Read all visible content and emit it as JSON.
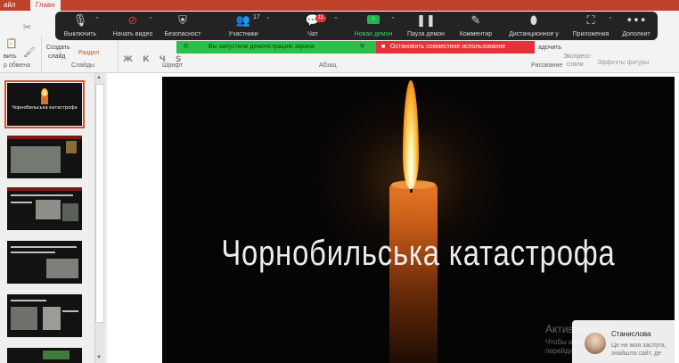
{
  "ribbon": {
    "tab_file": "айл",
    "tab_home": "Главн",
    "paste_label": "вить",
    "new_slide_label": "Создать",
    "new_slide_label2": "слайд",
    "section_label": "Раздел",
    "clipboard_group": "р обмена",
    "slides_group": "Слайды",
    "font_group": "Шрифт",
    "paragraph_group": "Абзац",
    "drawing_group": "Рисование",
    "font_buttons": "Ж К Ч S",
    "align_label": "адочить",
    "express_styles_label": "Экспресс-",
    "express_styles_label2": "стили",
    "shape_effects_label": "Эффекты фигуры"
  },
  "zoom_toolbar": {
    "items": [
      {
        "label": "Выключить",
        "icon": "microphone-icon"
      },
      {
        "label": "Начать видео",
        "icon": "video-off-icon"
      },
      {
        "label": "Безопасност",
        "icon": "shield-icon"
      },
      {
        "label": "Участники",
        "icon": "participants-icon",
        "count": "17"
      },
      {
        "label": "Чат",
        "icon": "chat-icon",
        "badge": "11"
      },
      {
        "label": "Новая демон",
        "icon": "share-screen-icon"
      },
      {
        "label": "Пауза демон",
        "icon": "pause-icon"
      },
      {
        "label": "Комментир",
        "icon": "pen-icon"
      },
      {
        "label": "Дистанционное у",
        "icon": "mouse-icon"
      },
      {
        "label": "Приложения",
        "icon": "apps-icon"
      },
      {
        "label": "Дополнит",
        "icon": "more-icon"
      }
    ],
    "share_banner": "Вы запустили демонстрацию экрана",
    "stop_share": "Остановить совместное использование",
    "accent_green": "#2cc04a",
    "accent_red": "#e8303b"
  },
  "thumbnails": [
    {
      "title": "Чорнобильська катастрофа"
    }
  ],
  "slide": {
    "title": "Чорнобильська катастрофа"
  },
  "watermark": {
    "title": "Активация Windows",
    "line": "Чтобы активировать Windows, перейдите в раздел \"Параметры\"."
  },
  "video_tile": {
    "name": "Станислова",
    "text": "Це не моя заслуга, знайшла сайт, де"
  }
}
